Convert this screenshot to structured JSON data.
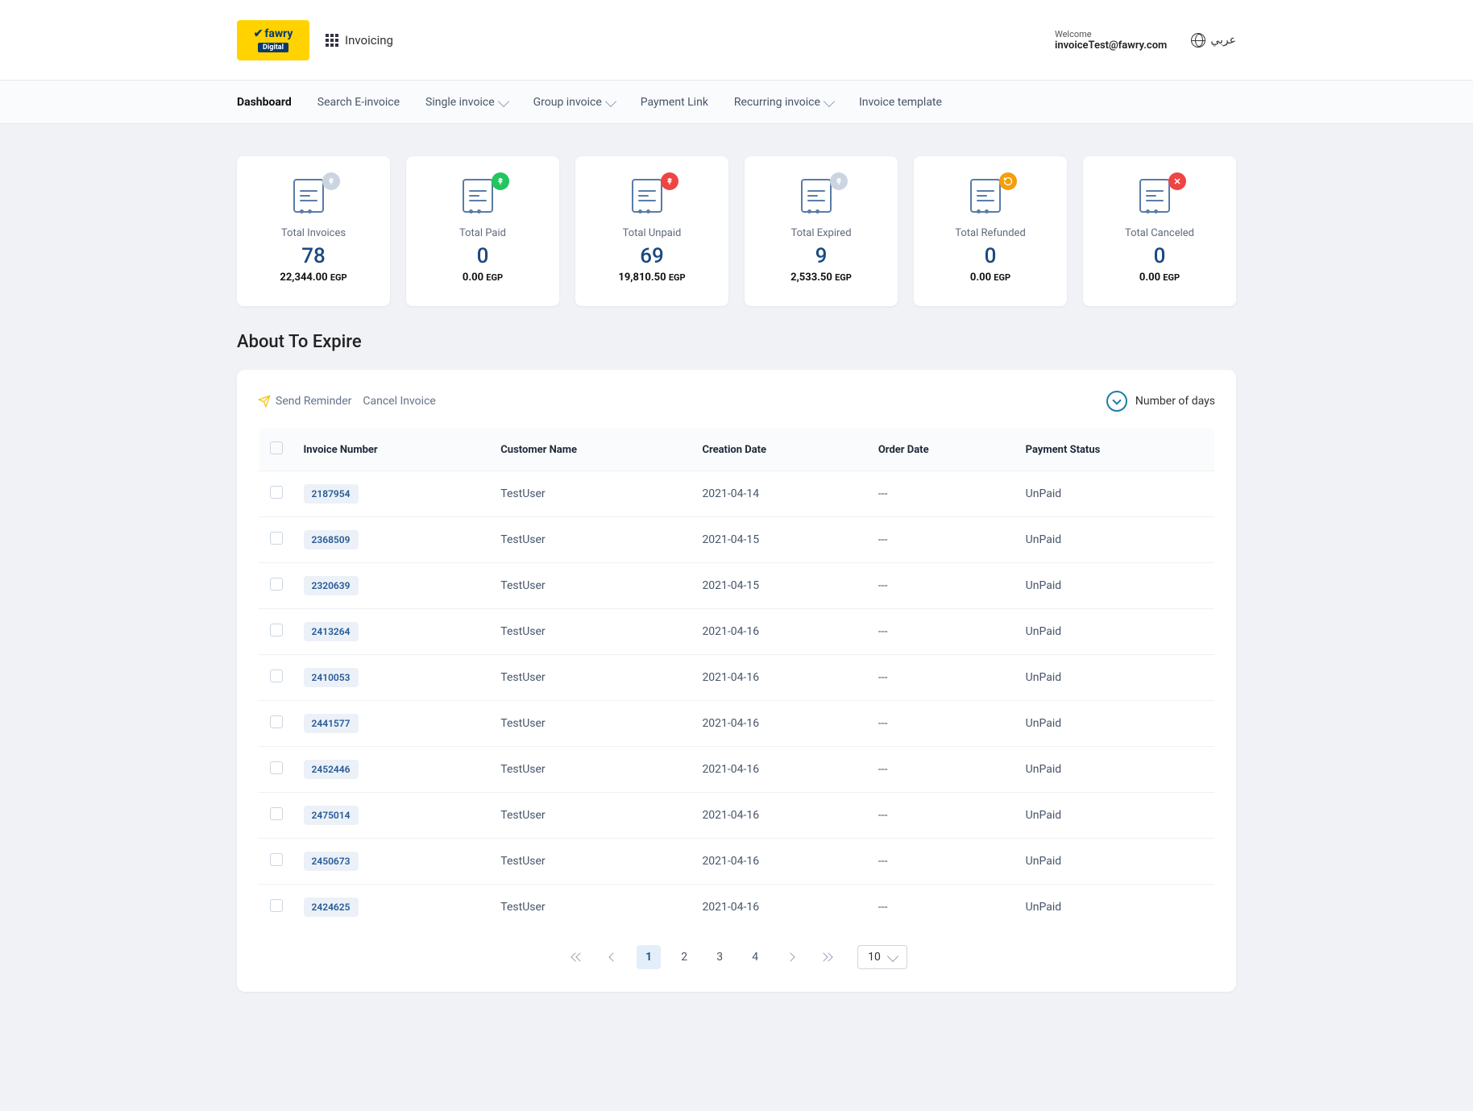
{
  "header": {
    "logo": {
      "brand": "fawry",
      "sub": "Digital"
    },
    "app_label": "Invoicing",
    "welcome": "Welcome",
    "email": "invoiceTest@fawry.com",
    "lang": "عربي"
  },
  "nav": [
    {
      "label": "Dashboard",
      "active": true,
      "dropdown": false
    },
    {
      "label": "Search E-invoice",
      "active": false,
      "dropdown": false
    },
    {
      "label": "Single invoice",
      "active": false,
      "dropdown": true
    },
    {
      "label": "Group invoice",
      "active": false,
      "dropdown": true
    },
    {
      "label": "Payment Link",
      "active": false,
      "dropdown": false
    },
    {
      "label": "Recurring invoice",
      "active": false,
      "dropdown": true
    },
    {
      "label": "Invoice template",
      "active": false,
      "dropdown": false
    }
  ],
  "cards": [
    {
      "title": "Total Invoices",
      "count": "78",
      "amount": "22,344.00",
      "currency": "EGP",
      "badge": "gray-dollar"
    },
    {
      "title": "Total Paid",
      "count": "0",
      "amount": "0.00",
      "currency": "EGP",
      "badge": "green-dollar"
    },
    {
      "title": "Total Unpaid",
      "count": "69",
      "amount": "19,810.50",
      "currency": "EGP",
      "badge": "red-dollar"
    },
    {
      "title": "Total Expired",
      "count": "9",
      "amount": "2,533.50",
      "currency": "EGP",
      "badge": "gray-dollar"
    },
    {
      "title": "Total Refunded",
      "count": "0",
      "amount": "0.00",
      "currency": "EGP",
      "badge": "yellow-refund"
    },
    {
      "title": "Total Canceled",
      "count": "0",
      "amount": "0.00",
      "currency": "EGP",
      "badge": "red-x"
    }
  ],
  "section_title": "About To Expire",
  "toolbar": {
    "send_reminder": "Send Reminder",
    "cancel_invoice": "Cancel Invoice",
    "num_days": "Number of days"
  },
  "table": {
    "headers": [
      "Invoice Number",
      "Customer Name",
      "Creation Date",
      "Order Date",
      "Payment Status"
    ],
    "rows": [
      {
        "num": "2187954",
        "customer": "TestUser",
        "creation": "2021-04-14",
        "order": "---",
        "status": "UnPaid"
      },
      {
        "num": "2368509",
        "customer": "TestUser",
        "creation": "2021-04-15",
        "order": "---",
        "status": "UnPaid"
      },
      {
        "num": "2320639",
        "customer": "TestUser",
        "creation": "2021-04-15",
        "order": "---",
        "status": "UnPaid"
      },
      {
        "num": "2413264",
        "customer": "TestUser",
        "creation": "2021-04-16",
        "order": "---",
        "status": "UnPaid"
      },
      {
        "num": "2410053",
        "customer": "TestUser",
        "creation": "2021-04-16",
        "order": "---",
        "status": "UnPaid"
      },
      {
        "num": "2441577",
        "customer": "TestUser",
        "creation": "2021-04-16",
        "order": "---",
        "status": "UnPaid"
      },
      {
        "num": "2452446",
        "customer": "TestUser",
        "creation": "2021-04-16",
        "order": "---",
        "status": "UnPaid"
      },
      {
        "num": "2475014",
        "customer": "TestUser",
        "creation": "2021-04-16",
        "order": "---",
        "status": "UnPaid"
      },
      {
        "num": "2450673",
        "customer": "TestUser",
        "creation": "2021-04-16",
        "order": "---",
        "status": "UnPaid"
      },
      {
        "num": "2424625",
        "customer": "TestUser",
        "creation": "2021-04-16",
        "order": "---",
        "status": "UnPaid"
      }
    ]
  },
  "pagination": {
    "pages": [
      "1",
      "2",
      "3",
      "4"
    ],
    "active": "1",
    "page_size": "10"
  }
}
